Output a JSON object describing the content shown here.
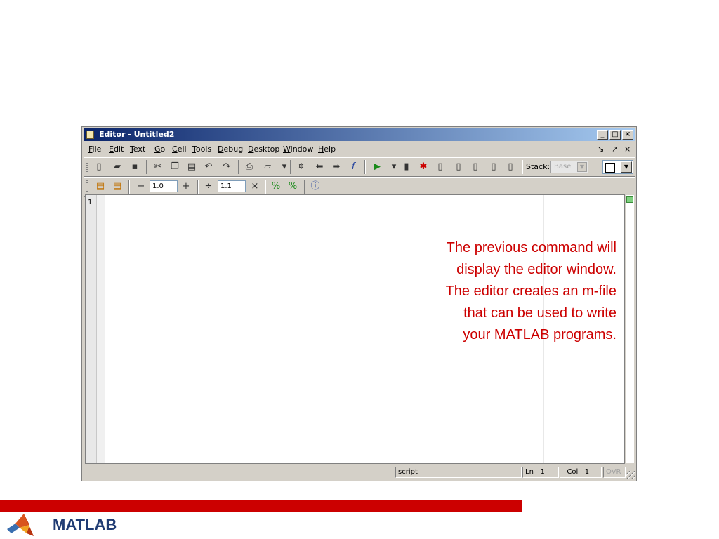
{
  "window": {
    "title": "Editor - Untitled2",
    "minimize": "_",
    "maximize": "□",
    "close": "×"
  },
  "menu": {
    "items": [
      "File",
      "Edit",
      "Text",
      "Go",
      "Cell",
      "Tools",
      "Debug",
      "Desktop",
      "Window",
      "Help"
    ],
    "dock": "↘",
    "undock": "↗",
    "close": "×"
  },
  "toolbar1": {
    "stack_label": "Stack:",
    "stack_value": "Base"
  },
  "toolbar2": {
    "minus": "−",
    "value1": "1.0",
    "plus": "+",
    "divide": "÷",
    "value2": "1.1",
    "times": "×"
  },
  "editor": {
    "line_numbers": [
      "1"
    ]
  },
  "statusbar": {
    "mode": "script",
    "ln_label": "Ln",
    "ln_value": "1",
    "col_label": "Col",
    "col_value": "1",
    "ovr": "OVR"
  },
  "annotation": {
    "lines": [
      "The previous command will",
      "display the editor window.",
      "The editor creates an m-file",
      "that can be used to write",
      "your MATLAB programs."
    ]
  },
  "footer": {
    "brand": "MATLAB"
  },
  "colors": {
    "accent_red": "#cc0000",
    "title_blue": "#0a246a",
    "brand_blue": "#1f3b73"
  }
}
